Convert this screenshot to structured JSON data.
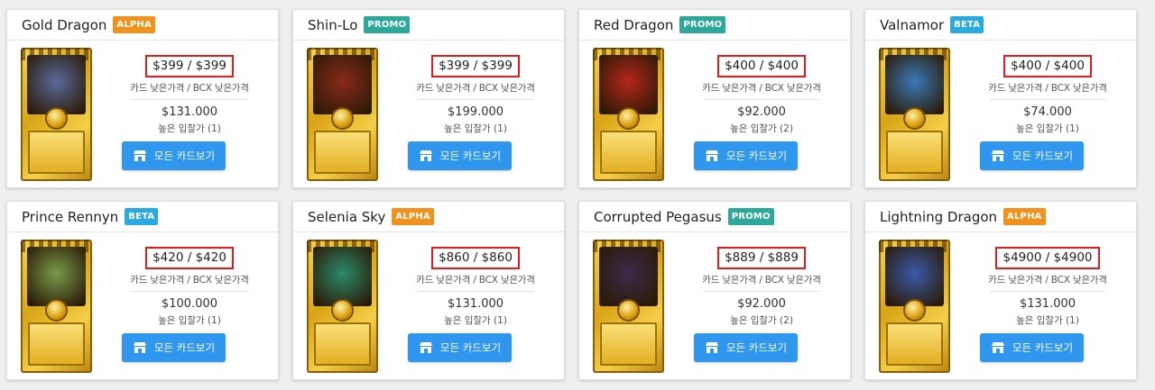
{
  "cards": [
    {
      "name": "Gold Dragon",
      "badge": "ALPHA",
      "price": "$399 / $399",
      "low_label": "카드 낮은가격 / BCX 낮은가격",
      "bid": "$131.000",
      "bid_label": "높은 입찰가 (1)",
      "button": "모든 카드보기",
      "art_color": "#5a6a9a"
    },
    {
      "name": "Shin-Lo",
      "badge": "PROMO",
      "price": "$399 / $399",
      "low_label": "카드 낮은가격 / BCX 낮은가격",
      "bid": "$199.000",
      "bid_label": "높은 입찰가 (1)",
      "button": "모든 카드보기",
      "art_color": "#8a2a1a"
    },
    {
      "name": "Red Dragon",
      "badge": "PROMO",
      "price": "$400 / $400",
      "low_label": "카드 낮은가격 / BCX 낮은가격",
      "bid": "$92.000",
      "bid_label": "높은 입찰가 (2)",
      "button": "모든 카드보기",
      "art_color": "#b6261c"
    },
    {
      "name": "Valnamor",
      "badge": "BETA",
      "price": "$400 / $400",
      "low_label": "카드 낮은가격 / BCX 낮은가격",
      "bid": "$74.000",
      "bid_label": "높은 입찰가 (1)",
      "button": "모든 카드보기",
      "art_color": "#3a7ab8"
    },
    {
      "name": "Prince Rennyn",
      "badge": "BETA",
      "price": "$420 / $420",
      "low_label": "카드 낮은가격 / BCX 낮은가격",
      "bid": "$100.000",
      "bid_label": "높은 입찰가 (1)",
      "button": "모든 카드보기",
      "art_color": "#7a9a4a"
    },
    {
      "name": "Selenia Sky",
      "badge": "ALPHA",
      "price": "$860 / $860",
      "low_label": "카드 낮은가격 / BCX 낮은가격",
      "bid": "$131.000",
      "bid_label": "높은 입찰가 (1)",
      "button": "모든 카드보기",
      "art_color": "#2a8a6a"
    },
    {
      "name": "Corrupted Pegasus",
      "badge": "PROMO",
      "price": "$889 / $889",
      "low_label": "카드 낮은가격 / BCX 낮은가격",
      "bid": "$92.000",
      "bid_label": "높은 입찰가 (2)",
      "button": "모든 카드보기",
      "art_color": "#3a2a4a"
    },
    {
      "name": "Lightning Dragon",
      "badge": "ALPHA",
      "price": "$4900 / $4900",
      "low_label": "카드 낮은가격 / BCX 낮은가격",
      "bid": "$131.000",
      "bid_label": "높은 입찰가 (1)",
      "button": "모든 카드보기",
      "art_color": "#3a5aa8"
    }
  ],
  "colors": {
    "button": "#2f97ed",
    "price_outline": "#e41b1b",
    "alpha": "#f0921c",
    "promo": "#2ea89a",
    "beta": "#2aabe0"
  }
}
